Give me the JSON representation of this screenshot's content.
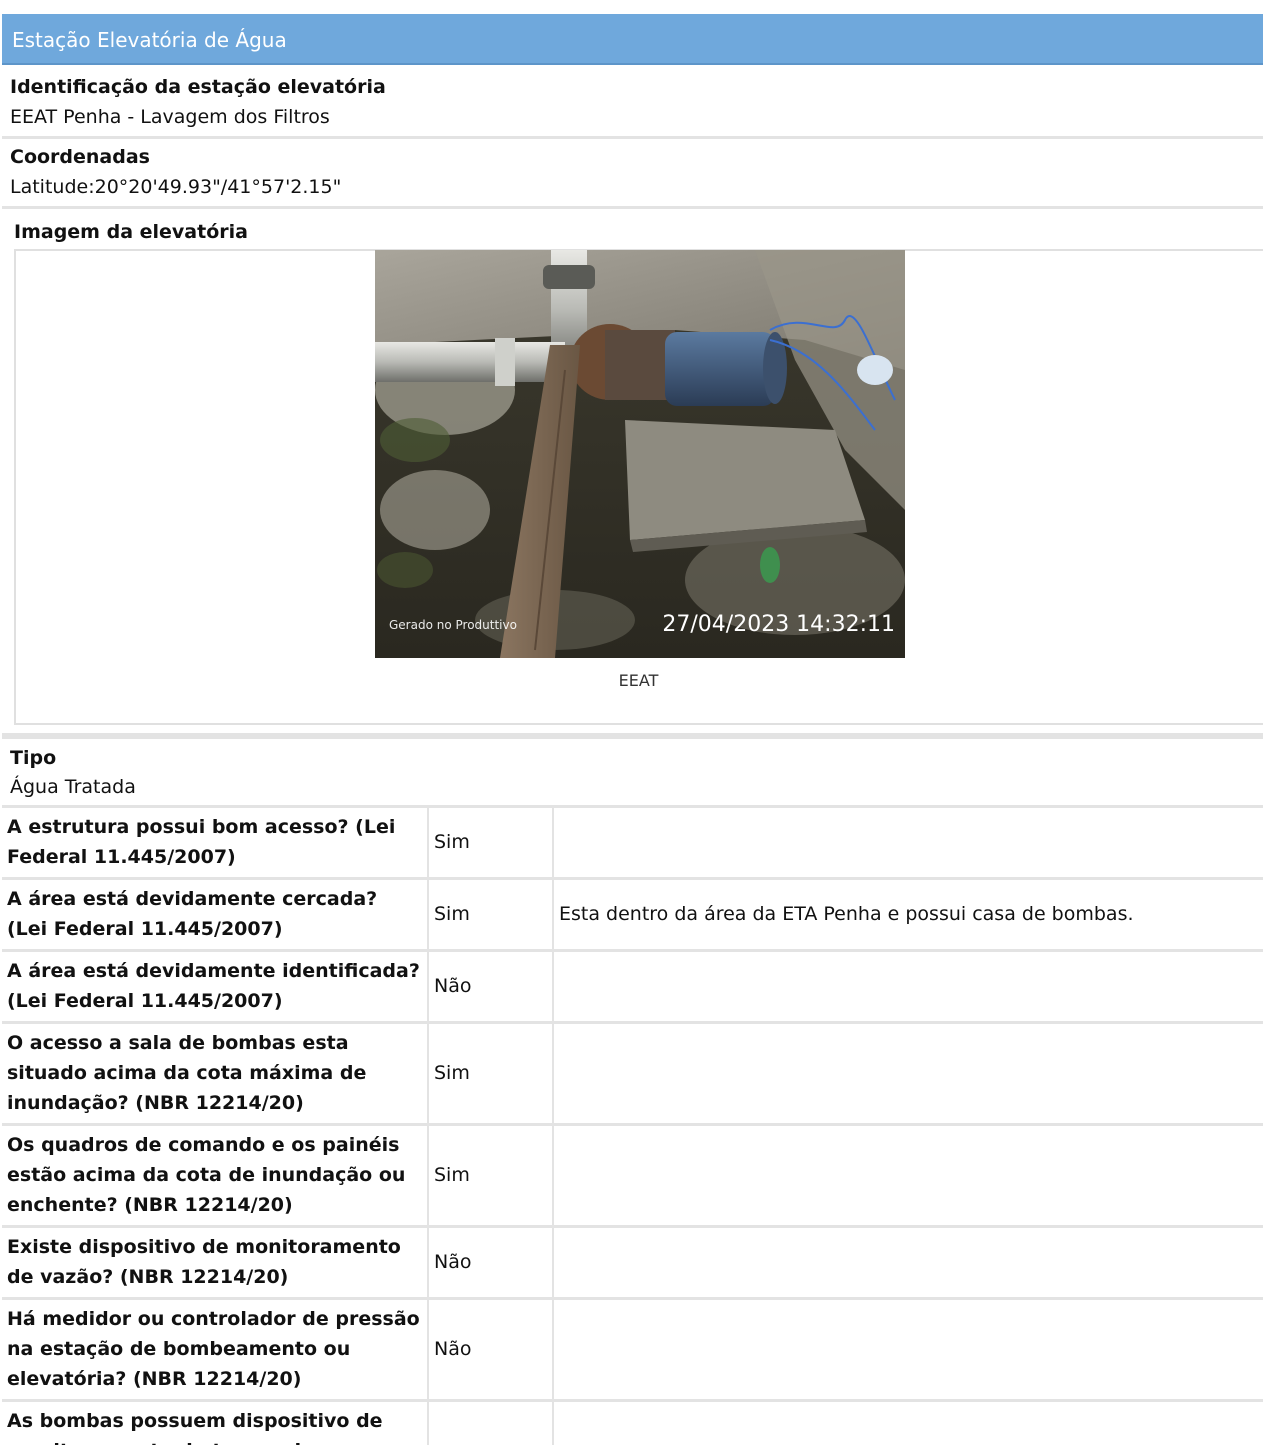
{
  "header": {
    "title": "Estação Elevatória de Água",
    "bar_color": "#6fa8dc"
  },
  "fields": {
    "identificacao": {
      "label": "Identificação da estação elevatória",
      "value": "EEAT Penha - Lavagem dos Filtros"
    },
    "coordenadas": {
      "label": "Coordenadas",
      "value": "Latitude:20°20'49.93\"/41°57'2.15\""
    },
    "imagem": {
      "label": "Imagem da elevatória",
      "caption": "EEAT",
      "photo_stamp_left": "Gerado no Produttivo",
      "photo_stamp_right": "27/04/2023 14:32:11"
    },
    "tipo": {
      "label": "Tipo",
      "value": "Água Tratada"
    }
  },
  "questions": [
    {
      "question": "A estrutura possui bom acesso? (Lei Federal 11.445/2007)",
      "answer": "Sim",
      "observation": ""
    },
    {
      "question": "A área está devidamente cercada? (Lei Federal 11.445/2007)",
      "answer": "Sim",
      "observation": "Esta dentro da área da ETA Penha e possui casa de bombas."
    },
    {
      "question": "A área está devidamente identificada? (Lei Federal 11.445/2007)",
      "answer": "Não",
      "observation": ""
    },
    {
      "question": "O acesso a sala de bombas esta situado acima da cota máxima de inundação? (NBR 12214/20)",
      "answer": "Sim",
      "observation": ""
    },
    {
      "question": "Os quadros de comando e os painéis estão acima da cota de inundação ou enchente? (NBR 12214/20)",
      "answer": "Sim",
      "observation": ""
    },
    {
      "question": "Existe dispositivo de monitoramento de vazão? (NBR 12214/20)",
      "answer": "Não",
      "observation": ""
    },
    {
      "question": "Há medidor ou controlador de pressão na estação de bombeamento ou elevatória? (NBR 12214/20)",
      "answer": "Não",
      "observation": ""
    },
    {
      "question": "As bombas possuem dispositivo de monitoramento do tempo de",
      "answer": "",
      "observation": ""
    }
  ]
}
